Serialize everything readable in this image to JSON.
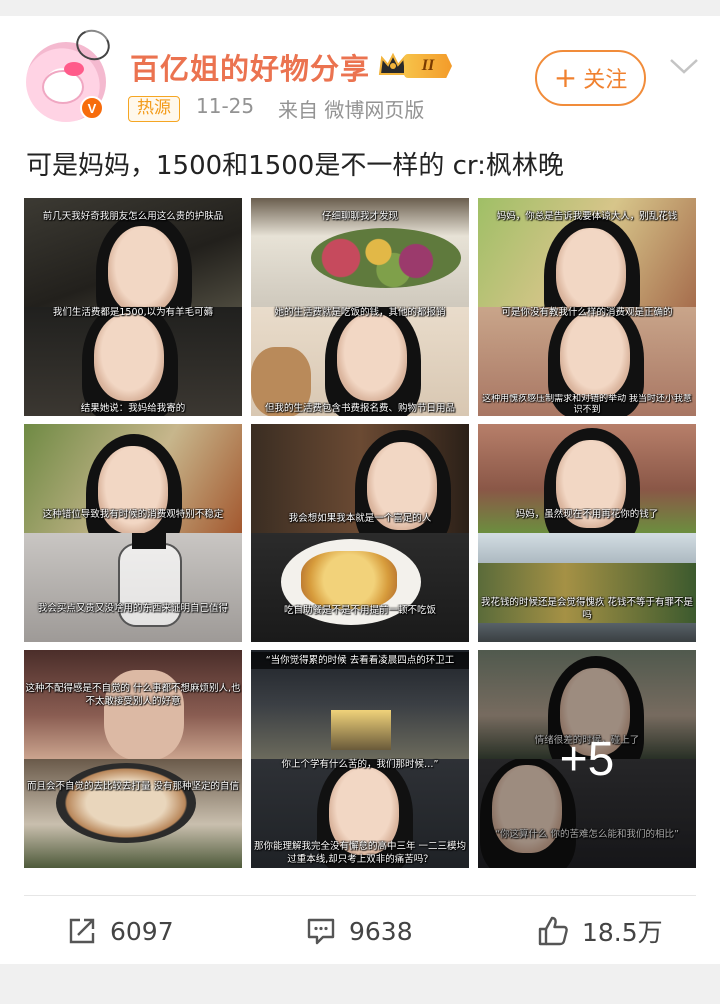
{
  "post": {
    "username": "百亿姐的好物分享",
    "level_badge": "II",
    "hot_tag": "热源",
    "date": "11-25",
    "source": "来自 微博网页版",
    "follow_label": "关注",
    "text": "可是妈妈，1500和1500是不一样的  cr:枫林晚"
  },
  "thumbnails": [
    {
      "top_caption": "前几天我好奇我朋友怎么用这么贵的护肤品",
      "mid_caption": "我们生活费都是1500,以为有羊毛可薅",
      "bottom_caption": "结果她说：我妈给我寄的"
    },
    {
      "top_caption": "仔细聊聊我才发现",
      "mid_caption": "她的生活费就是吃饭的钱，其他的都报销",
      "bottom_caption": "但我的生活费包含书费报名费、购物节日用品"
    },
    {
      "top_caption": "妈妈，你总是告诉我要体谅大人，别乱花钱",
      "mid_caption": "可是你没有教我什么样的消费观是正确的",
      "bottom_caption": "这种用愧疚感压制需求和对错的举动 我当时还小我意识不到"
    },
    {
      "top_caption": "",
      "mid_caption": "这种错位导致我有时候的消费观特别不稳定",
      "bottom_caption": "我会买点又贵又没啥用的东西来证明自己值得"
    },
    {
      "top_caption": "",
      "mid_caption": "我会想如果我本就是一个富足的人",
      "bottom_caption": "吃自助餐是不是不用提前一顿不吃饭"
    },
    {
      "top_caption": "",
      "mid_caption": "妈妈，虽然现在不用再花你的钱了",
      "bottom_caption": "我花钱的时候还是会觉得愧疚 花钱不等于有罪不是吗"
    },
    {
      "top_caption": "这种不配得感是不自觉的 什么事都不想麻烦别人,也不太敢接受别人的好意",
      "mid_caption": "而且会不自觉的去比较去打量 没有那种坚定的自信",
      "bottom_caption": ""
    },
    {
      "top_caption": "“当你觉得累的时候 去看看凌晨四点的环卫工",
      "mid_caption": "你上个学有什么苦的，我们那时候…”",
      "bottom_caption": "那你能理解我完全没有懈怠的高中三年 一二三模均过重本线,却只考上双非的痛苦吗？"
    },
    {
      "top_caption": "",
      "mid_caption": "情绪很差的时候，碰上了",
      "bottom_caption": "“你这算什么 你的苦难怎么能和我们的相比”",
      "more_count": "+5"
    }
  ],
  "actions": {
    "share_count": "6097",
    "comment_count": "9638",
    "like_count": "18.5万"
  },
  "colors": {
    "username": "#eb7350",
    "follow": "#f0812f",
    "meta": "#939393",
    "hot_tag": "#f39b1a"
  },
  "icons": [
    "verified-badge-icon",
    "crown-icon",
    "plus-icon",
    "chevron-down-icon",
    "share-icon",
    "comment-icon",
    "like-icon"
  ]
}
